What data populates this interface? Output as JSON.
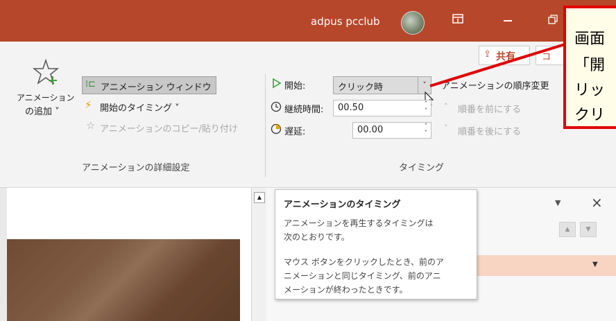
{
  "titlebar": {
    "user_name": "adpus pcclub",
    "restore_icon": "restore-icon",
    "minimize_icon": "minimize-icon",
    "maximize_icon": "maximize-icon",
    "color": "#b7472a"
  },
  "ribbon": {
    "share_label": "共有",
    "comment_label": "コ",
    "advanced": {
      "add_animation_line1": "アニメーション",
      "add_animation_line2": "の追加 ˅",
      "animation_window": "アニメーション ウィンドウ",
      "trigger": "開始のタイミング ˅",
      "animation_painter": "アニメーションのコピー/貼り付け",
      "group_label": "アニメーションの詳細設定"
    },
    "timing": {
      "start_label": "開始:",
      "start_value": "クリック時",
      "duration_label": "継続時間:",
      "duration_value": "00.50",
      "delay_label": "遅延:",
      "delay_value": "00.00",
      "reorder_title": "アニメーションの順序変更",
      "move_earlier": "順番を前にする",
      "move_later": "順番を後にする",
      "group_label": "タイミング"
    }
  },
  "tooltip": {
    "title": "アニメーションのタイミング",
    "line1": "アニメーションを再生するタイミングは",
    "line2": "次のとおりです。",
    "line3": "マウス ボタンをクリックしたとき、前のア",
    "line4": "ニメーションと同じタイミング、前のアニ",
    "line5": "メーションが終わったときです。"
  },
  "callout": {
    "line1": "画面",
    "line2": "「開",
    "line3": "リッ",
    "line4": "クリ",
    "border_color": "#e00000"
  }
}
